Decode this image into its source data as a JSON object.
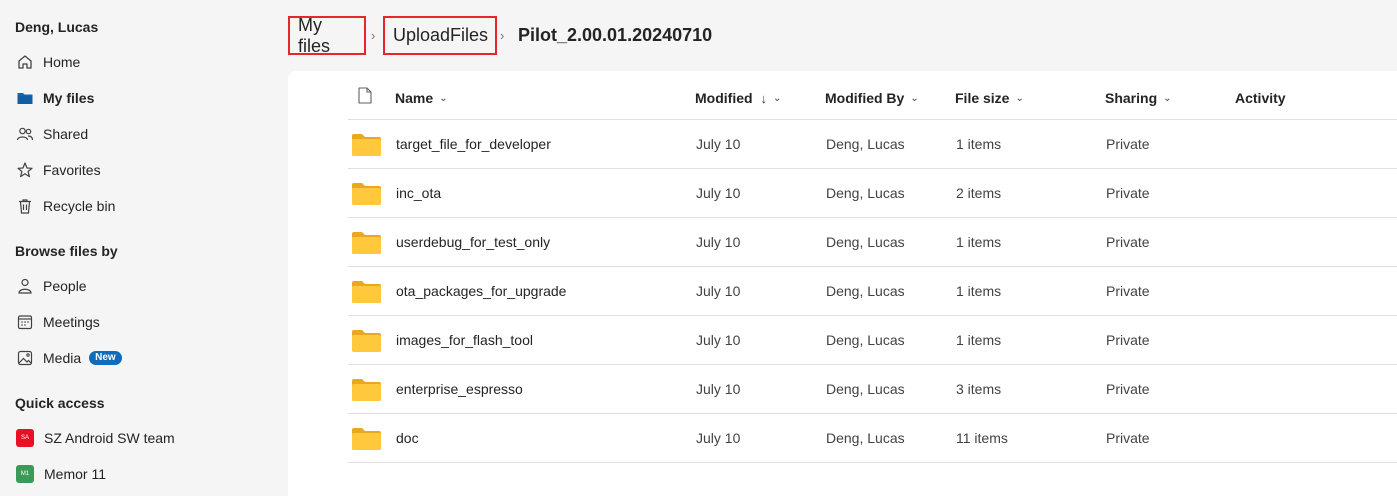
{
  "sidebar": {
    "user_name": "Deng, Lucas",
    "nav": [
      {
        "label": "Home",
        "icon": "home-icon"
      },
      {
        "label": "My files",
        "icon": "folder-icon"
      },
      {
        "label": "Shared",
        "icon": "people-icon"
      },
      {
        "label": "Favorites",
        "icon": "star-icon"
      },
      {
        "label": "Recycle bin",
        "icon": "trash-icon"
      }
    ],
    "browse_title": "Browse files by",
    "browse": [
      {
        "label": "People",
        "icon": "person-icon"
      },
      {
        "label": "Meetings",
        "icon": "calendar-icon"
      },
      {
        "label": "Media",
        "icon": "image-icon",
        "badge": "New"
      }
    ],
    "quick_title": "Quick access",
    "quick": [
      {
        "label": "SZ Android SW team",
        "abbr": "SA",
        "color": "#e81123"
      },
      {
        "label": "Memor 11",
        "abbr": "M1",
        "color": "#3b9a57"
      }
    ]
  },
  "breadcrumb": {
    "items": [
      "My files",
      "UploadFiles"
    ],
    "current": "Pilot_2.00.01.20240710"
  },
  "table": {
    "headers": {
      "name": "Name",
      "modified": "Modified",
      "modified_by": "Modified By",
      "file_size": "File size",
      "sharing": "Sharing",
      "activity": "Activity"
    },
    "rows": [
      {
        "name": "target_file_for_developer",
        "modified": "July 10",
        "modified_by": "Deng, Lucas",
        "size": "1 items",
        "sharing": "Private"
      },
      {
        "name": "inc_ota",
        "modified": "July 10",
        "modified_by": "Deng, Lucas",
        "size": "2 items",
        "sharing": "Private"
      },
      {
        "name": "userdebug_for_test_only",
        "modified": "July 10",
        "modified_by": "Deng, Lucas",
        "size": "1 items",
        "sharing": "Private"
      },
      {
        "name": "ota_packages_for_upgrade",
        "modified": "July 10",
        "modified_by": "Deng, Lucas",
        "size": "1 items",
        "sharing": "Private"
      },
      {
        "name": "images_for_flash_tool",
        "modified": "July 10",
        "modified_by": "Deng, Lucas",
        "size": "1 items",
        "sharing": "Private"
      },
      {
        "name": "enterprise_espresso",
        "modified": "July 10",
        "modified_by": "Deng, Lucas",
        "size": "3 items",
        "sharing": "Private"
      },
      {
        "name": "doc",
        "modified": "July 10",
        "modified_by": "Deng, Lucas",
        "size": "11 items",
        "sharing": "Private"
      }
    ]
  },
  "colors": {
    "accent": "#0f6cbd",
    "highlight_box": "#e8262a",
    "folder_yellow": "#ffc83d"
  }
}
